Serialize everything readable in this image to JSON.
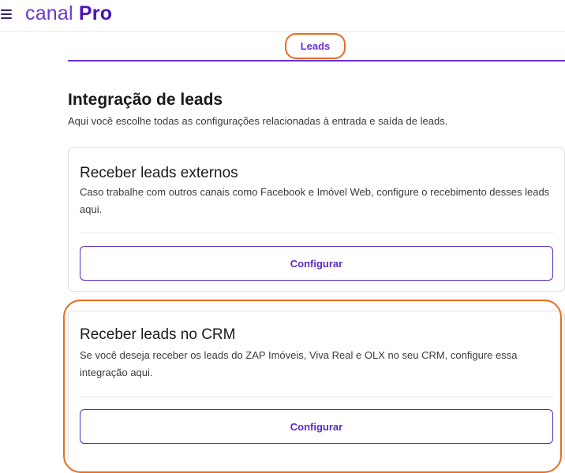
{
  "header": {
    "menu_icon": "hamburger-menu-icon",
    "logo_light": "canal",
    "logo_bold": "Pro",
    "brand_color": "#5b2bbf"
  },
  "tabs": [
    {
      "label": "Leads",
      "active": true
    }
  ],
  "page": {
    "title": "Integração de leads",
    "subtitle": "Aqui você escolhe todas as configurações relacionadas à entrada e saída de leads."
  },
  "cards": [
    {
      "title": "Receber leads externos",
      "description": "Caso trabalhe com outros canais como Facebook e Imóvel Web, configure o recebimento desses leads aqui.",
      "button_label": "Configurar"
    },
    {
      "title": "Receber leads no CRM",
      "description": "Se você deseja receber os leads do ZAP Imóveis, Viva Real e OLX no seu CRM, configure essa integração aqui.",
      "button_label": "Configurar"
    }
  ],
  "colors": {
    "accent": "#6b2fd6",
    "highlight": "#ec6b1f"
  }
}
